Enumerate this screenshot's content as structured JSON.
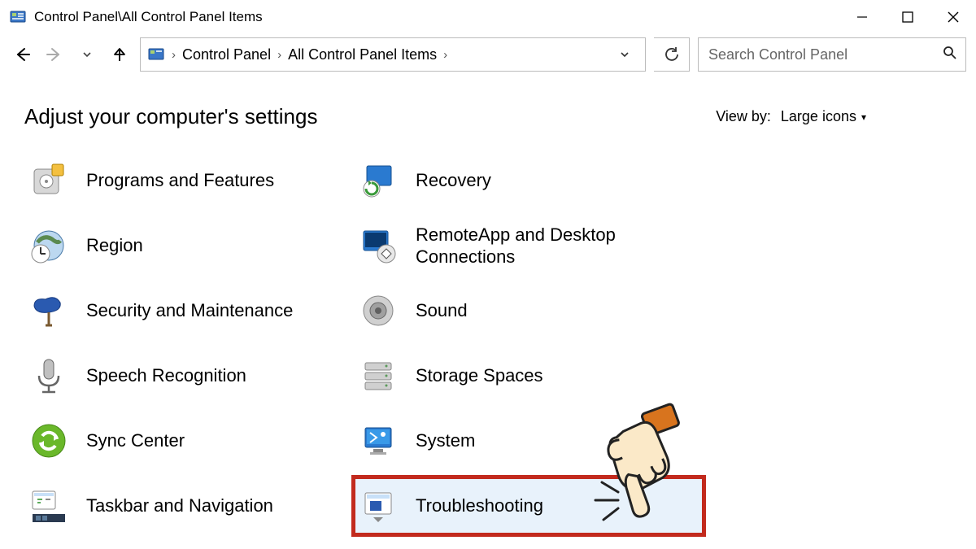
{
  "window": {
    "title": "Control Panel\\All Control Panel Items"
  },
  "breadcrumb": {
    "root": "Control Panel",
    "current": "All Control Panel Items"
  },
  "search": {
    "placeholder": "Search Control Panel"
  },
  "header": {
    "title": "Adjust your computer's settings",
    "viewby_label": "View by:",
    "viewby_value": "Large icons"
  },
  "items": {
    "programs_features": "Programs and Features",
    "recovery": "Recovery",
    "region": "Region",
    "remoteapp": "RemoteApp and Desktop Connections",
    "security_maintenance": "Security and Maintenance",
    "sound": "Sound",
    "speech_recognition": "Speech Recognition",
    "storage_spaces": "Storage Spaces",
    "sync_center": "Sync Center",
    "system": "System",
    "taskbar_navigation": "Taskbar and Navigation",
    "troubleshooting": "Troubleshooting"
  }
}
